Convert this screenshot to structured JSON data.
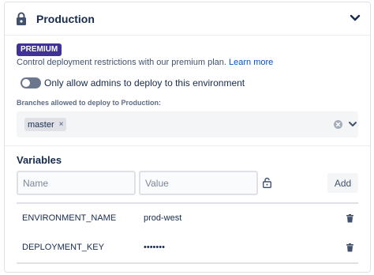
{
  "header": {
    "title": "Production",
    "lock_icon": "lock-icon",
    "chevron_icon": "chevron-down-icon"
  },
  "premium": {
    "badge": "PREMIUM",
    "description": "Control deployment restrictions with our premium plan.",
    "link": "Learn more"
  },
  "toggle": {
    "label": "Only allow admins to deploy to this environment",
    "on": false
  },
  "branches": {
    "label": "Branches allowed to deploy to Production:",
    "tags": [
      "master"
    ],
    "tag_remove_glyph": "×"
  },
  "variables": {
    "title": "Variables",
    "name_placeholder": "Name",
    "value_placeholder": "Value",
    "add_label": "Add",
    "rows": [
      {
        "name": "ENVIRONMENT_NAME",
        "value": "prod-west"
      },
      {
        "name": "DEPLOYMENT_KEY",
        "value": "•••••••"
      }
    ]
  },
  "colors": {
    "badge_bg": "#403294",
    "link": "#0052cc",
    "text": "#172b4d",
    "muted": "#42526e",
    "toggle_off": "#6b778c"
  }
}
